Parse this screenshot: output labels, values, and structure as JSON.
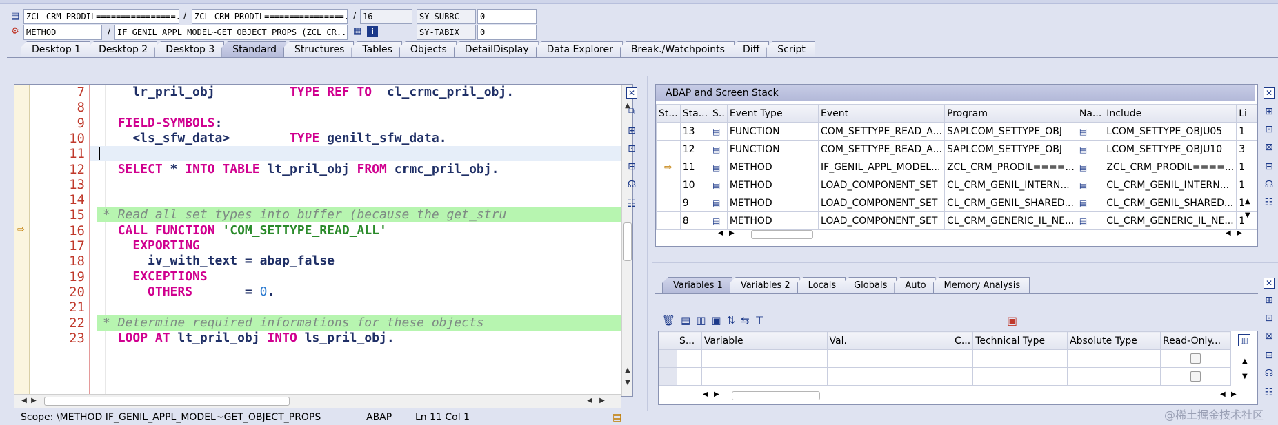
{
  "header": {
    "field1": "ZCL_CRM_PRODIL================...",
    "sep1": "/",
    "field2": "ZCL_CRM_PRODIL================...",
    "sep2": "/",
    "line_no": "16",
    "sy_subrc_label": "SY-SUBRC",
    "sy_subrc_value": "0",
    "event_type": "METHOD",
    "sep3": "/",
    "method_name": "IF_GENIL_APPL_MODEL~GET_OBJECT_PROPS (ZCL_CR...",
    "sy_tabix_label": "SY-TABIX",
    "sy_tabix_value": "0"
  },
  "main_tabs": [
    "Desktop 1",
    "Desktop 2",
    "Desktop 3",
    "Standard",
    "Structures",
    "Tables",
    "Objects",
    "DetailDisplay",
    "Data Explorer",
    "Break./Watchpoints",
    "Diff",
    "Script"
  ],
  "active_main_tab": "Standard",
  "editor": {
    "lines": [
      {
        "n": "7",
        "html": "    lr_pril_obj          <span class=\"kw\">TYPE REF TO</span>  cl_crmc_pril_obj."
      },
      {
        "n": "8",
        "html": ""
      },
      {
        "n": "9",
        "html": "  <span class=\"kw\">FIELD-SYMBOLS</span>:"
      },
      {
        "n": "10",
        "html": "    &lt;ls_sfw_data&gt;        <span class=\"kw\">TYPE</span> genilt_sfw_data."
      },
      {
        "n": "11",
        "html": ""
      },
      {
        "n": "12",
        "html": "  <span class=\"kw\">SELECT</span> * <span class=\"kw\">INTO TABLE</span> lt_pril_obj <span class=\"kw\">FROM</span> crmc_pril_obj."
      },
      {
        "n": "13",
        "html": ""
      },
      {
        "n": "14",
        "html": ""
      },
      {
        "n": "15",
        "html": "<span class=\"cmt\">* Read all set types into buffer (because the get_stru</span>"
      },
      {
        "n": "16",
        "html": "  <span class=\"kw\">CALL FUNCTION</span> <span class=\"str\">'COM_SETTYPE_READ_ALL'</span>"
      },
      {
        "n": "17",
        "html": "    <span class=\"kw\">EXPORTING</span>"
      },
      {
        "n": "18",
        "html": "      iv_with_text = abap_false"
      },
      {
        "n": "19",
        "html": "    <span class=\"kw\">EXCEPTIONS</span>"
      },
      {
        "n": "20",
        "html": "      <span class=\"kw\">OTHERS</span>       = <span class=\"num\">0</span>."
      },
      {
        "n": "21",
        "html": ""
      },
      {
        "n": "22",
        "html": "<span class=\"cmt\">* Determine required informations for these objects</span>"
      },
      {
        "n": "23",
        "html": "  <span class=\"kw\">LOOP AT</span> lt_pril_obj <span class=\"kw\">INTO</span> ls_pril_obj."
      }
    ],
    "current_line": "16",
    "cursor_line": "11"
  },
  "stack_panel": {
    "title": "ABAP and Screen Stack",
    "columns": [
      "St...",
      "Sta...",
      "S..",
      "Event Type",
      "Event",
      "Program",
      "Na...",
      "Include",
      "Li"
    ],
    "rows": [
      {
        "marker": "",
        "level": "13",
        "type": "FUNCTION",
        "event": "COM_SETTYPE_READ_A...",
        "program": "SAPLCOM_SETTYPE_OBJ",
        "include": "LCOM_SETTYPE_OBJU05",
        "line": "1"
      },
      {
        "marker": "",
        "level": "12",
        "type": "FUNCTION",
        "event": "COM_SETTYPE_READ_A...",
        "program": "SAPLCOM_SETTYPE_OBJ",
        "include": "LCOM_SETTYPE_OBJU10",
        "line": "3"
      },
      {
        "marker": "⇨",
        "level": "11",
        "type": "METHOD",
        "event": "IF_GENIL_APPL_MODEL...",
        "program": "ZCL_CRM_PRODIL====...",
        "include": "ZCL_CRM_PRODIL====...",
        "line": "1"
      },
      {
        "marker": "",
        "level": "10",
        "type": "METHOD",
        "event": "LOAD_COMPONENT_SET",
        "program": "CL_CRM_GENIL_INTERN...",
        "include": "CL_CRM_GENIL_INTERN...",
        "line": "1"
      },
      {
        "marker": "",
        "level": "9",
        "type": "METHOD",
        "event": "LOAD_COMPONENT_SET",
        "program": "CL_CRM_GENIL_SHARED...",
        "include": "CL_CRM_GENIL_SHARED...",
        "line": "1"
      },
      {
        "marker": "",
        "level": "8",
        "type": "METHOD",
        "event": "LOAD_COMPONENT_SET",
        "program": "CL_CRM_GENERIC_IL_NE...",
        "include": "CL_CRM_GENERIC_IL_NE...",
        "line": "1"
      }
    ]
  },
  "var_tabs": [
    "Variables 1",
    "Variables 2",
    "Locals",
    "Globals",
    "Auto",
    "Memory Analysis"
  ],
  "active_var_tab": "Variables 1",
  "var_table": {
    "columns": [
      "S...",
      "Variable",
      "Val.",
      "C...",
      "Technical Type",
      "Absolute Type",
      "Read-Only..."
    ]
  },
  "status_bar": {
    "scope": "Scope: \\METHOD IF_GENIL_APPL_MODEL~GET_OBJECT_PROPS",
    "lang": "ABAP",
    "position": "Ln  11 Col  1"
  },
  "watermark": "@稀土掘金技术社区",
  "colors": {
    "keyword": "#d0008f",
    "comment_bg": "#b7f5b0",
    "string": "#2a8a2a",
    "line_number": "#c0392b",
    "tab_active": "#b4bad9"
  }
}
